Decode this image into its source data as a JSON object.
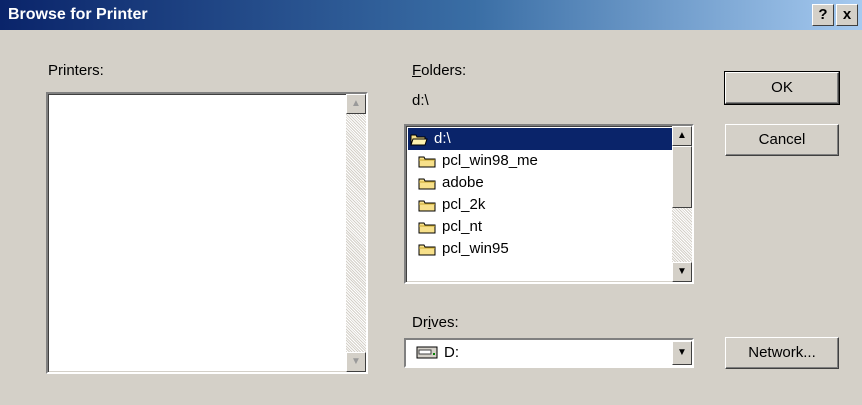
{
  "window": {
    "title": "Browse for Printer",
    "help_button": "?",
    "close_button": "x"
  },
  "printers": {
    "label": "Printers:",
    "items": []
  },
  "folders": {
    "label_prefix": "",
    "label_mnemonic": "F",
    "label_rest": "olders:",
    "current_path": "d:\\",
    "items": [
      {
        "name": "d:\\",
        "icon": "open-folder-icon",
        "selected": true
      },
      {
        "name": "pcl_win98_me",
        "icon": "folder-icon",
        "selected": false
      },
      {
        "name": "adobe",
        "icon": "folder-icon",
        "selected": false
      },
      {
        "name": "pcl_2k",
        "icon": "folder-icon",
        "selected": false
      },
      {
        "name": "pcl_nt",
        "icon": "folder-icon",
        "selected": false
      },
      {
        "name": "pcl_win95",
        "icon": "folder-icon",
        "selected": false
      }
    ]
  },
  "drives": {
    "label_prefix": "Dr",
    "label_mnemonic": "i",
    "label_rest": "ves:",
    "selected": "D:",
    "icon": "drive-icon"
  },
  "buttons": {
    "ok": "OK",
    "cancel": "Cancel",
    "network": "Network..."
  },
  "colors": {
    "titlebar_start": "#0a246a",
    "titlebar_end": "#a6caf0",
    "face": "#d4d0c8",
    "selection": "#0a246a"
  }
}
